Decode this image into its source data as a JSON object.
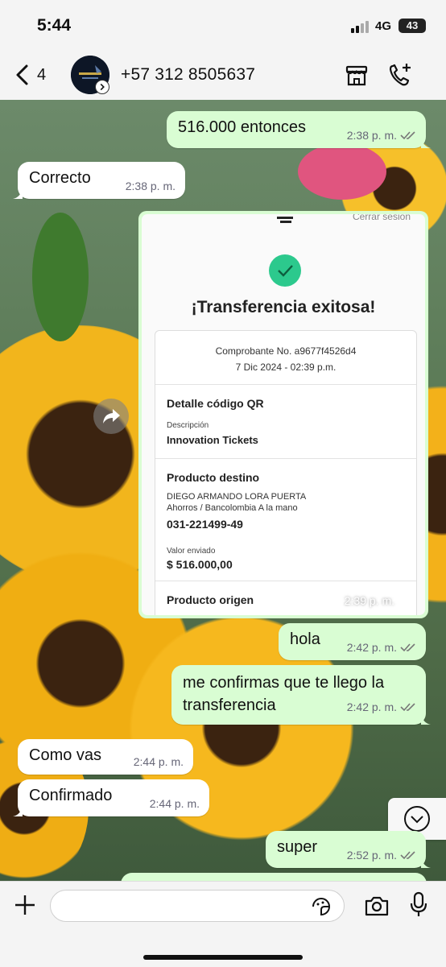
{
  "status_bar": {
    "time": "5:44",
    "network": "4G",
    "battery": "43"
  },
  "header": {
    "back_count": "4",
    "contact": "+57 312 8505637",
    "icons": [
      "back-chevron-icon",
      "shop-icon",
      "call-add-icon"
    ]
  },
  "messages": [
    {
      "dir": "out",
      "text": "516.000 entonces",
      "time": "2:38 p. m."
    },
    {
      "dir": "in",
      "text": "Correcto",
      "time": "2:38 p. m."
    },
    {
      "dir": "out",
      "type": "image",
      "time": "2:39 p. m."
    },
    {
      "dir": "out",
      "text": "hola",
      "time": "2:42 p. m."
    },
    {
      "dir": "out",
      "text": "me confirmas que te llego la transferencia",
      "line1": "me confirmas que te llego la",
      "line2": "transferencia",
      "time": "2:42 p. m."
    },
    {
      "dir": "in",
      "text": "Como vas",
      "time": "2:44 p. m."
    },
    {
      "dir": "in",
      "text": "Confirmado",
      "time": "2:44 p. m."
    },
    {
      "dir": "out",
      "text": "super",
      "time": "2:52 p. m."
    }
  ],
  "receipt": {
    "top_text": "Cerrar sesión",
    "title": "¡Transferencia exitosa!",
    "voucher": "Comprobante No. a9677f4526d4",
    "date": "7 Dic 2024 - 02:39 p.m.",
    "qr_heading": "Detalle código QR",
    "desc_label": "Descripción",
    "desc_value": "Innovation Tickets",
    "dest_heading": "Producto destino",
    "dest_name": "DIEGO ARMANDO LORA PUERTA",
    "dest_account_type": "Ahorros / Bancolombia A la mano",
    "dest_account": "031-221499-49",
    "sent_label": "Valor enviado",
    "sent_value": "$ 516.000,00",
    "origin_heading": "Producto origen"
  },
  "composer": {
    "placeholder": ""
  },
  "colors": {
    "outgoing": "#d9fdd3",
    "incoming": "#ffffff",
    "check": "#2cc98d"
  }
}
